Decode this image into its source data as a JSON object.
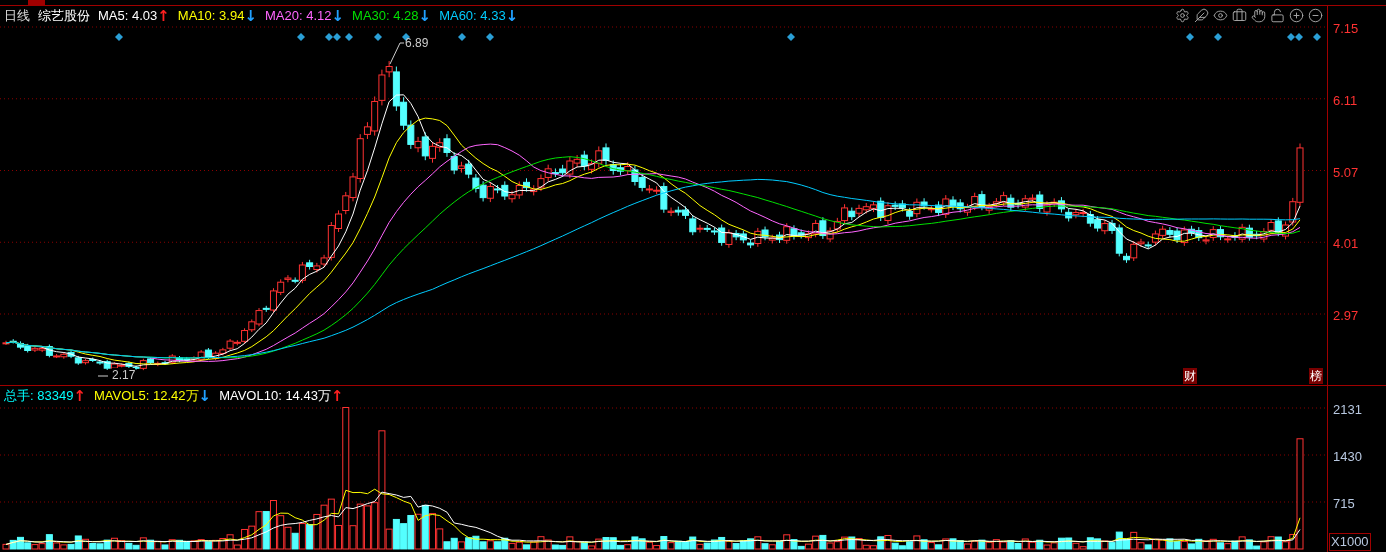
{
  "header": {
    "period": "日线",
    "stock_name": "综艺股份",
    "moving_averages": [
      {
        "label": "MA5:",
        "value": "4.03",
        "arrow": {
          "text": "↑",
          "color": "#ff2020"
        },
        "color": "#ffffff"
      },
      {
        "label": "MA10:",
        "value": "3.94",
        "arrow": {
          "text": "↓",
          "color": "#20a0ff"
        },
        "color": "#ffff00"
      },
      {
        "label": "MA20:",
        "value": "4.12",
        "arrow": {
          "text": "↓",
          "color": "#20a0ff"
        },
        "color": "#ff66ff"
      },
      {
        "label": "MA30:",
        "value": "4.28",
        "arrow": {
          "text": "↓",
          "color": "#20a0ff"
        },
        "color": "#00e000"
      },
      {
        "label": "MA60:",
        "value": "4.33",
        "arrow": {
          "text": "↓",
          "color": "#20a0ff"
        },
        "color": "#00ccff"
      }
    ]
  },
  "price_axis": {
    "ticks": [
      "7.15",
      "6.11",
      "5.07",
      "4.01",
      "2.97"
    ]
  },
  "annotations": {
    "high": "6.89",
    "low": "2.17"
  },
  "event_badges": [
    {
      "label": "财"
    },
    {
      "label": "榜"
    }
  ],
  "volume_header": {
    "items": [
      {
        "label": "总手:",
        "value": "83349",
        "arrow": {
          "text": "↑",
          "color": "#ff2020"
        },
        "color": "#00ffff"
      },
      {
        "label": "MAVOL5:",
        "value": "12.42万",
        "arrow": {
          "text": "↓",
          "color": "#20a0ff"
        },
        "color": "#ffff00"
      },
      {
        "label": "MAVOL10:",
        "value": "14.43万",
        "arrow": {
          "text": "↑",
          "color": "#ff2020"
        },
        "color": "#ffffff"
      }
    ]
  },
  "volume_axis": {
    "ticks": [
      "2131",
      "1430",
      "715"
    ],
    "unit": "X1000"
  }
}
